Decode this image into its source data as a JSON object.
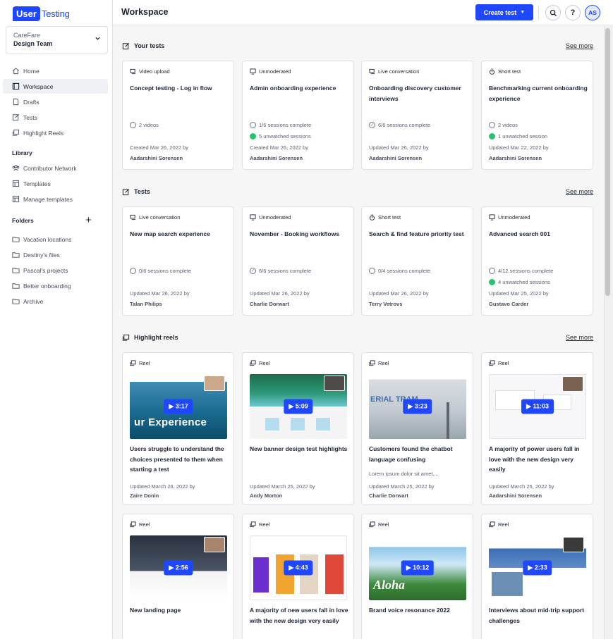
{
  "brand": {
    "logo_box": "User",
    "logo_text": "Testing",
    "accent": "#1f47ff"
  },
  "team": {
    "org": "CareFare",
    "name": "Design Team"
  },
  "nav": {
    "home": "Home",
    "workspace": "Workspace",
    "drafts": "Drafts",
    "tests": "Tests",
    "highlight_reels": "Highlight Reels"
  },
  "library": {
    "label": "Library",
    "contributor_network": "Contributor Network",
    "templates": "Templates",
    "manage_templates": "Manage templates"
  },
  "folders": {
    "label": "Folders",
    "items": [
      "Vacation locations",
      "Destiny's files",
      "Pascal's projects",
      "Better onboarding",
      "Archive"
    ]
  },
  "header": {
    "title": "Workspace",
    "create_test": "Create test",
    "help": "?",
    "avatar": "AS"
  },
  "your_tests": {
    "title": "Your tests",
    "see_more": "See more",
    "cards": [
      {
        "type": "Video upload",
        "title": "Concept testing - Log in flow",
        "stat1": "2 videos",
        "stat2": "",
        "meta": "Created Mar 26, 2022 by",
        "author": "Aadarshini Sorensen"
      },
      {
        "type": "Unmoderated",
        "title": "Admin onboarding experience",
        "stat1": "1/6 sessions complete",
        "stat2": "5 unwatched sessions",
        "meta": "Created Mar 26, 2022 by",
        "author": "Aadarshini Sorensen"
      },
      {
        "type": "Live conversation",
        "title": "Onboarding discovery customer interviews",
        "stat1": "6/6 sessions complete",
        "stat2": "",
        "meta": "Updated Mar 26, 2022 by",
        "author": "Aadarshini Sorensen"
      },
      {
        "type": "Short test",
        "title": "Benchmarking current onboarding experience",
        "stat1": "2 videos",
        "stat2": "1 unwatched session",
        "meta": "Updated Mar 22, 2022 by",
        "author": "Aadarshini Sorensen"
      }
    ]
  },
  "tests": {
    "title": "Tests",
    "see_more": "See more",
    "cards": [
      {
        "type": "Live conversation",
        "title": "New map search experience",
        "stat1": "0/6 sessions complete",
        "stat2": "",
        "meta": "Updated Mar 26, 2022 by",
        "author": "Talan Philips"
      },
      {
        "type": "Unmoderated",
        "title": "November - Booking workflows",
        "stat1": "6/6 sessions complete",
        "stat2": "",
        "meta": "Updated Mar 26, 2022 by",
        "author": "Charlie Dorwart"
      },
      {
        "type": "Short test",
        "title": "Search & find feature priority test",
        "stat1": "0/4 sessions complete",
        "stat2": "",
        "meta": "Updated Mar 26, 2022 by",
        "author": "Terry Vetrovs"
      },
      {
        "type": "Unmoderated",
        "title": "Advanced search 001",
        "stat1": "4/12 sessions complete",
        "stat2": "4 unwatched sessions",
        "meta": "Updated Mar 25, 2022 by",
        "author": "Gustavo Carder"
      }
    ]
  },
  "reels": {
    "title": "Highlight reels",
    "see_more": "See more",
    "label": "Reel",
    "cards": [
      {
        "duration": "3:17",
        "title": "Users struggle to understand the choices presented to them when starting a test",
        "desc": "",
        "meta": "Updated March 26, 2022 by",
        "author": "Zaire Donin",
        "thumb_text": "ur Experience"
      },
      {
        "duration": "5:09",
        "title": "New banner design test highlights",
        "desc": "",
        "meta": "Updated March 25, 2022 by",
        "author": "Andy Morton",
        "thumb_text": ""
      },
      {
        "duration": "3:23",
        "title": "Customers found the chatbot language confusing",
        "desc": "Lorem ipsum dolor sit amet,...",
        "meta": "Updated March 25, 2022 by",
        "author": "Charlie Dorwart",
        "thumb_text": "ERIAL TRAM"
      },
      {
        "duration": "11:03",
        "title": "A majority of power users fall in love with the new design very easily",
        "desc": "",
        "meta": "Updated March 25, 2022 by",
        "author": "Aadarshini Sorensen",
        "thumb_text": ""
      },
      {
        "duration": "2:56",
        "title": "New landing page",
        "desc": "",
        "meta": "",
        "author": "",
        "thumb_text": ""
      },
      {
        "duration": "4:43",
        "title": "A majority of new users fall in love with the new design very easily",
        "desc": "",
        "meta": "",
        "author": "",
        "thumb_text": ""
      },
      {
        "duration": "10:12",
        "title": "Brand voice resonance 2022",
        "desc": "",
        "meta": "",
        "author": "",
        "thumb_text": "Aloha"
      },
      {
        "duration": "2:33",
        "title": "Interviews about mid-trip support challenges",
        "desc": "",
        "meta": "",
        "author": "",
        "thumb_text": ""
      }
    ]
  }
}
